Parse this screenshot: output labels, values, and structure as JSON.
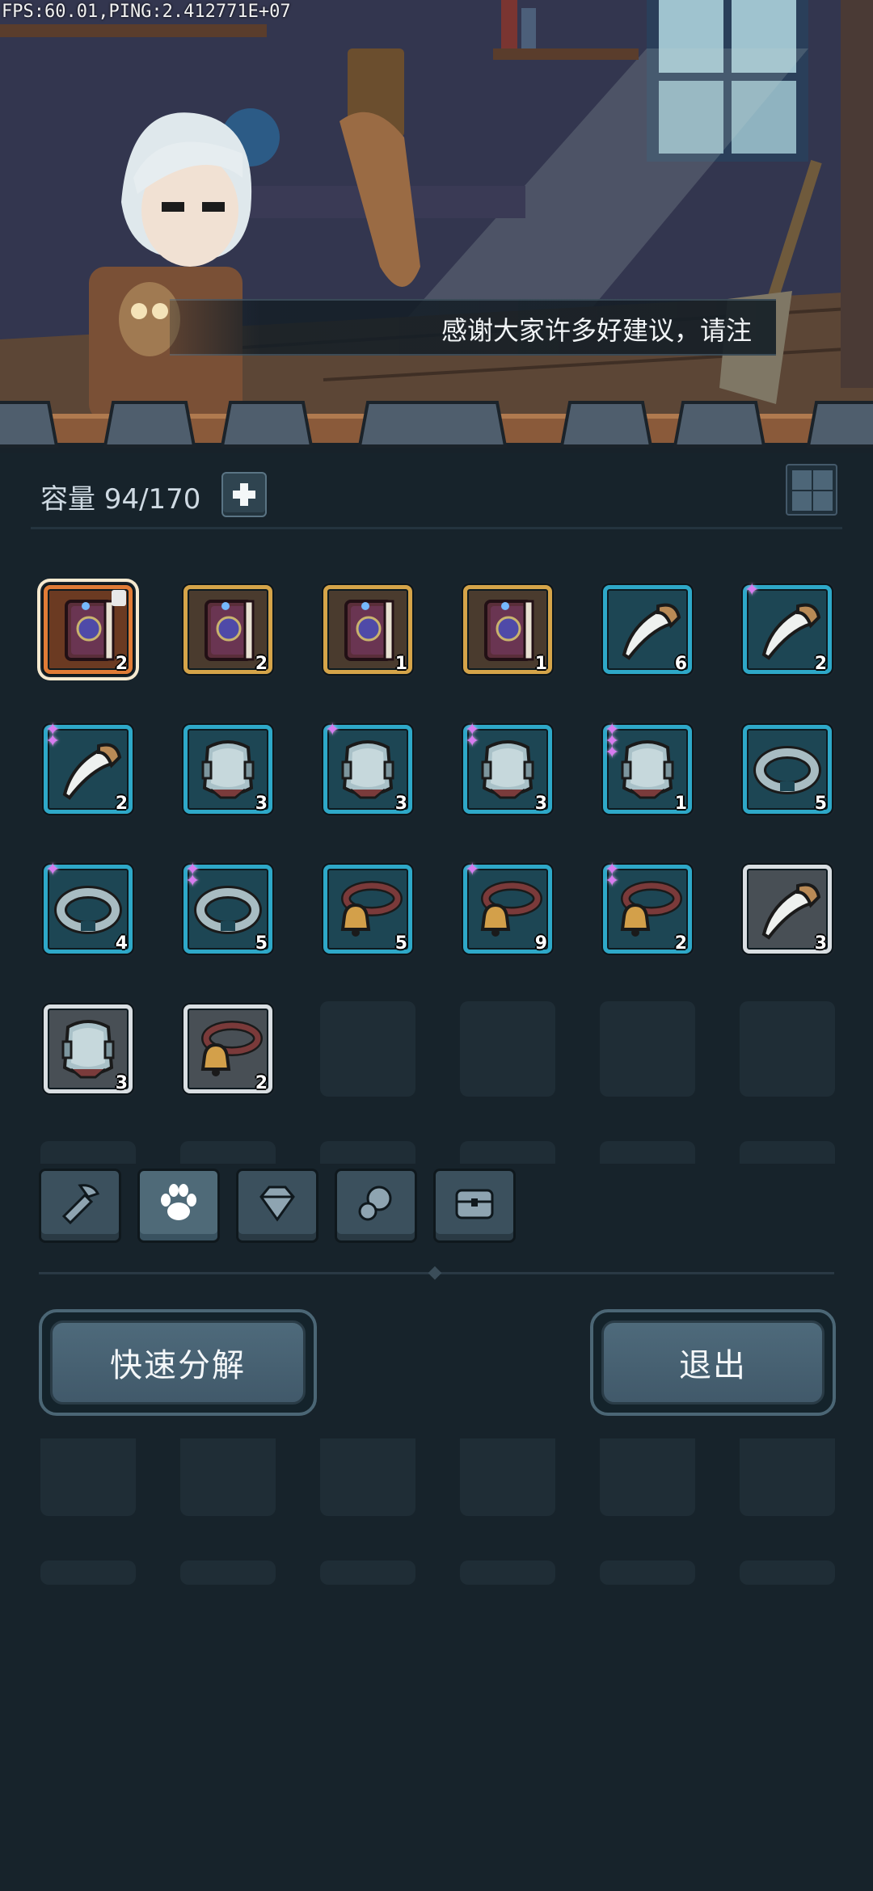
{
  "debug": {
    "fps_text": "FPS:60.01,PING:2.412771E+07"
  },
  "scene": {
    "dialog_text": "感谢大家许多好建议，请注"
  },
  "inventory": {
    "capacity_label": "容量 94/170",
    "slots": [
      {
        "icon": "spellbook-icon",
        "count": "2",
        "rarity": "orange",
        "stars": 0
      },
      {
        "icon": "spellbook-icon",
        "count": "2",
        "rarity": "gold",
        "stars": 0
      },
      {
        "icon": "spellbook-icon",
        "count": "1",
        "rarity": "gold",
        "stars": 0
      },
      {
        "icon": "spellbook-icon",
        "count": "1",
        "rarity": "gold",
        "stars": 0
      },
      {
        "icon": "claw-fang-icon",
        "count": "6",
        "rarity": "blue",
        "stars": 0
      },
      {
        "icon": "claw-fang-icon",
        "count": "2",
        "rarity": "blue",
        "stars": 1
      },
      {
        "icon": "claw-fang-icon",
        "count": "2",
        "rarity": "blue",
        "stars": 2
      },
      {
        "icon": "pet-armor-icon",
        "count": "3",
        "rarity": "blue",
        "stars": 0
      },
      {
        "icon": "pet-armor-icon",
        "count": "3",
        "rarity": "blue",
        "stars": 1
      },
      {
        "icon": "pet-armor-icon",
        "count": "3",
        "rarity": "blue",
        "stars": 2
      },
      {
        "icon": "pet-armor-icon",
        "count": "1",
        "rarity": "blue",
        "stars": 3
      },
      {
        "icon": "collar-ring-icon",
        "count": "5",
        "rarity": "blue",
        "stars": 0
      },
      {
        "icon": "collar-ring-icon",
        "count": "4",
        "rarity": "blue",
        "stars": 1
      },
      {
        "icon": "collar-ring-icon",
        "count": "5",
        "rarity": "blue",
        "stars": 2
      },
      {
        "icon": "bell-collar-icon",
        "count": "5",
        "rarity": "blue",
        "stars": 0
      },
      {
        "icon": "bell-collar-icon",
        "count": "9",
        "rarity": "blue",
        "stars": 1
      },
      {
        "icon": "bell-collar-icon",
        "count": "2",
        "rarity": "blue",
        "stars": 2
      },
      {
        "icon": "claw-fang-icon",
        "count": "3",
        "rarity": "white",
        "stars": 0
      },
      {
        "icon": "pet-armor-icon",
        "count": "3",
        "rarity": "white",
        "stars": 0
      },
      {
        "icon": "bell-collar-icon",
        "count": "2",
        "rarity": "white",
        "stars": 0
      }
    ]
  },
  "tabs": [
    {
      "icon": "weapon-tools-icon",
      "active": false
    },
    {
      "icon": "paw-icon",
      "active": true
    },
    {
      "icon": "gem-icon",
      "active": false
    },
    {
      "icon": "material-stones-icon",
      "active": false
    },
    {
      "icon": "chest-icon",
      "active": false
    }
  ],
  "buttons": {
    "quick_decompose": "快速分解",
    "exit": "退出"
  },
  "colors": {
    "rarity_orange": "#e07b36",
    "rarity_gold": "#d5a449",
    "rarity_blue": "#2ea8c8",
    "rarity_white": "#d9dee2",
    "star": "#d77cf0"
  }
}
